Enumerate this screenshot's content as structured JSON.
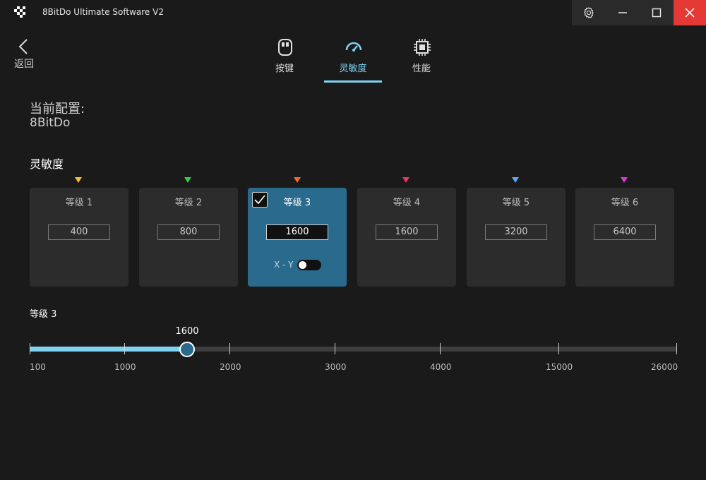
{
  "app": {
    "title": "8BitDo Ultimate Software V2"
  },
  "nav": {
    "back_label": "返回"
  },
  "tabs": [
    {
      "label": "按键",
      "icon": "mouse-icon",
      "active": false
    },
    {
      "label": "灵敏度",
      "icon": "gauge-icon",
      "active": true
    },
    {
      "label": "性能",
      "icon": "chip-icon",
      "active": false
    }
  ],
  "profile": {
    "label": "当前配置:",
    "name": "8BitDo"
  },
  "sensitivity": {
    "title": "灵敏度",
    "levels": [
      {
        "label": "等级 1",
        "dpi": "400",
        "color": "#f2c232",
        "selected": false
      },
      {
        "label": "等级 2",
        "dpi": "800",
        "color": "#3cc84a",
        "selected": false
      },
      {
        "label": "等级 3",
        "dpi": "1600",
        "color": "#ef6a2e",
        "selected": true
      },
      {
        "label": "等级 4",
        "dpi": "1600",
        "color": "#e8395a",
        "selected": false
      },
      {
        "label": "等级 5",
        "dpi": "3200",
        "color": "#5aa7ef",
        "selected": false
      },
      {
        "label": "等级 6",
        "dpi": "6400",
        "color": "#d83ad8",
        "selected": false
      }
    ],
    "xy_label": "X - Y",
    "xy_enabled": false
  },
  "slider": {
    "title": "等级 3",
    "value": "1600",
    "ticks": [
      "100",
      "1000",
      "2000",
      "3000",
      "4000",
      "15000",
      "26000"
    ]
  }
}
